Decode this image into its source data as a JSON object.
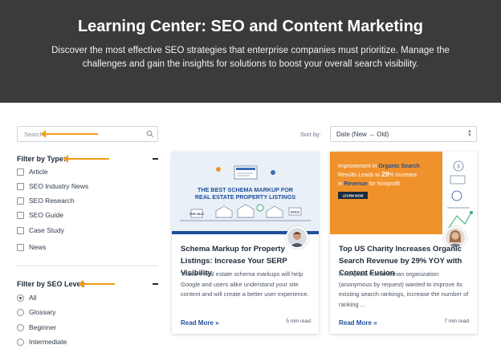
{
  "hero": {
    "title": "Learning Center: SEO and Content Marketing",
    "subtitle": "Discover the most effective SEO strategies that enterprise companies must prioritize. Manage the challenges and gain the insights for solutions to boost your overall search visibility."
  },
  "search": {
    "placeholder": "Search",
    "icon": "search-icon"
  },
  "filters": {
    "type": {
      "title": "Filter by Type:",
      "options": [
        "Article",
        "SEO Industry News",
        "SEO Research",
        "SEO Guide",
        "Case Study",
        "News"
      ]
    },
    "level": {
      "title": "Filter by SEO Level:",
      "options": [
        "All",
        "Glossary",
        "Beginner",
        "Intermediate"
      ],
      "selected": "All"
    }
  },
  "sort": {
    "label": "Sort by:",
    "value": "Date (New → Old)"
  },
  "cards": [
    {
      "image_caption_1": "THE BEST SCHEMA MARKUP FOR",
      "image_caption_2": "REAL ESTATE PROPERTY LISTINGS",
      "sign_1": "FOR SALE",
      "sign_2": "SOLD",
      "title": "Schema Markup for Property Listings: Increase Your SERP Visibility",
      "excerpt": "These 7 real estate schema markups will help Google and users alike understand your site content and will create a better user experience.",
      "read_more": "Read More »",
      "read_time": "5 min read"
    },
    {
      "image_line_1a": "Improvement in ",
      "image_line_1b": "Organic Search",
      "image_line_2a": "Results Leads to ",
      "image_line_2b": "29",
      "image_line_2c": "% Increase",
      "image_line_3a": "in ",
      "image_line_3b": "Revenue",
      "image_line_3c": " for Nonprofit",
      "image_button": "LEARN NOW",
      "title": "Top US Charity Increases Organic Search Revenue by 29% YOY with Content Fusion",
      "excerpt": "A nonprofit humanitarian organization (anonymous by request) wanted to improve its existing search rankings, increase the number of ranking ...",
      "read_more": "Read More »",
      "read_time": "7 min read"
    }
  ],
  "colors": {
    "hero_bg": "#3a3b3c",
    "accent_arrow": "#f39c12",
    "link": "#1e4f9b",
    "card2_bg": "#f0922b"
  }
}
